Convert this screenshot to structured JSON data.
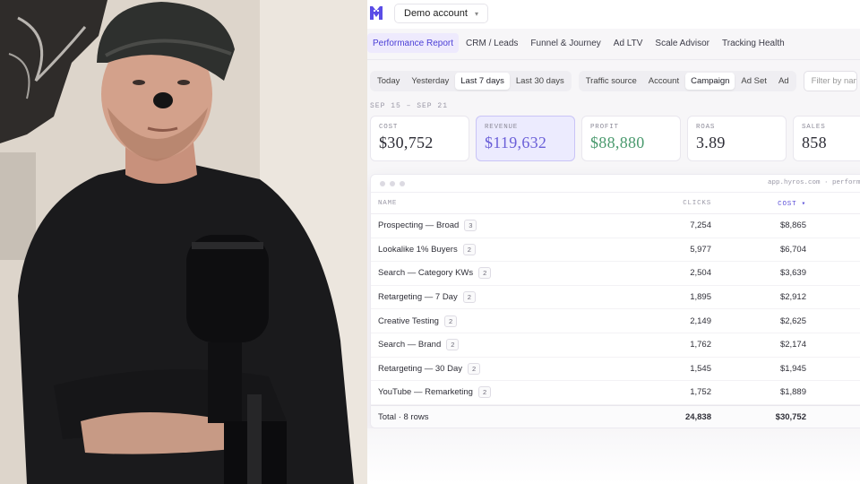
{
  "account": {
    "label": "Demo account",
    "chevron_icon": "chevron-down-icon"
  },
  "nav": {
    "tabs": [
      {
        "label": "Performance Report",
        "active": true
      },
      {
        "label": "CRM / Leads"
      },
      {
        "label": "Funnel & Journey"
      },
      {
        "label": "Ad LTV"
      },
      {
        "label": "Scale Advisor"
      },
      {
        "label": "Tracking Health"
      }
    ]
  },
  "filters": {
    "ranges": [
      "Today",
      "Yesterday",
      "Last 7 days",
      "Last 30 days"
    ],
    "active_range": "Last 7 days",
    "levels": [
      "Traffic source",
      "Account",
      "Campaign",
      "Ad Set",
      "Ad"
    ],
    "active_level": "Campaign",
    "search_placeholder": "Filter by name"
  },
  "date_range": "SEP 15 – SEP 21",
  "kpis": [
    {
      "label": "COST",
      "value": "$30,752"
    },
    {
      "label": "REVENUE",
      "value": "$119,632"
    },
    {
      "label": "PROFIT",
      "value": "$88,880"
    },
    {
      "label": "ROAS",
      "value": "3.89"
    },
    {
      "label": "SALES",
      "value": "858"
    }
  ],
  "table": {
    "url": "app.hyros.com · performance",
    "headers": {
      "name": "NAME",
      "clicks": "CLICKS",
      "cost": "COST ▾"
    },
    "rows": [
      {
        "name": "Prospecting — Broad",
        "badge": "3",
        "clicks": "7,254",
        "cost": "$8,865"
      },
      {
        "name": "Lookalike 1% Buyers",
        "badge": "2",
        "clicks": "5,977",
        "cost": "$6,704"
      },
      {
        "name": "Search — Category KWs",
        "badge": "2",
        "clicks": "2,504",
        "cost": "$3,639"
      },
      {
        "name": "Retargeting — 7 Day",
        "badge": "2",
        "clicks": "1,895",
        "cost": "$2,912"
      },
      {
        "name": "Creative Testing",
        "badge": "2",
        "clicks": "2,149",
        "cost": "$2,625"
      },
      {
        "name": "Search — Brand",
        "badge": "2",
        "clicks": "1,762",
        "cost": "$2,174"
      },
      {
        "name": "Retargeting — 30 Day",
        "badge": "2",
        "clicks": "1,545",
        "cost": "$1,945"
      },
      {
        "name": "YouTube — Remarketing",
        "badge": "2",
        "clicks": "1,752",
        "cost": "$1,889"
      }
    ],
    "total": {
      "name": "Total · 8 rows",
      "clicks": "24,838",
      "cost": "$30,752"
    }
  },
  "colors": {
    "accent": "#4b3fd6",
    "revenue_bg": "#ecebfe",
    "profit": "#4a9a6e"
  }
}
